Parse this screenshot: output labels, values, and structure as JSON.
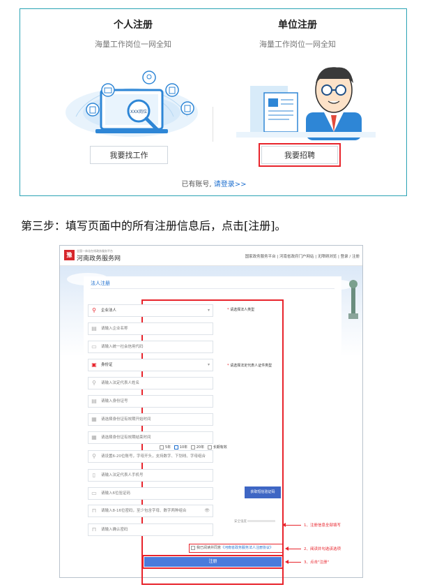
{
  "top": {
    "personal": {
      "title": "个人注册",
      "subtitle": "海量工作岗位一网全知",
      "button": "我要找工作",
      "badge": "XXX岗位"
    },
    "company": {
      "title": "单位注册",
      "subtitle": "海量工作岗位一网全知",
      "button": "我要招聘"
    },
    "login_prompt": "已有账号,",
    "login_link": "请登录>>"
  },
  "step_text": "第三步：填写页面中的所有注册信息后，点击[注册]。",
  "reg": {
    "logo_mark": "豫",
    "logo_small": "全国一体化在线政务服务平台",
    "site_name": "河南政务服务网",
    "top_links": "国家政务服务平台 | 河南省政府门户网站 | 无障碍浏览 | 登录 / 注册",
    "tab": "法人注册",
    "fields": [
      {
        "icon": "person-icon",
        "glyph": "⚲",
        "text": "企业法人",
        "select": true
      },
      {
        "icon": "building-icon",
        "glyph": "▤",
        "text": "请输入企业名称"
      },
      {
        "icon": "card-icon",
        "glyph": "▭",
        "text": "请输入统一社会信用代码"
      },
      {
        "icon": "id-badge-icon",
        "glyph": "▣",
        "text": "身份证",
        "select": true
      },
      {
        "icon": "user-icon",
        "glyph": "⚲",
        "text": "请输入法定代表人姓名"
      },
      {
        "icon": "id-card-icon",
        "glyph": "▤",
        "text": "请输入身份证号"
      },
      {
        "icon": "calendar-icon",
        "glyph": "▦",
        "text": "请选择身份证有效期开始时间"
      },
      {
        "icon": "calendar-icon",
        "glyph": "▦",
        "text": "请选择身份证有效期结束时间"
      },
      {
        "icon": "user-icon",
        "glyph": "⚲",
        "text": "请设置6-20位账号，字母开头，支持数字、下划线、字母组合"
      },
      {
        "icon": "phone-icon",
        "glyph": "▯",
        "text": "请输入法定代表人手机号"
      },
      {
        "icon": "message-icon",
        "glyph": "▭",
        "text": "请输入6位验证码"
      },
      {
        "icon": "lock-icon",
        "glyph": "⊓",
        "text": "请输入8-16位密码，至少包含字母、数字两种组合",
        "eye": "👁"
      },
      {
        "icon": "lock-icon",
        "glyph": "⊓",
        "text": "请输入确认密码"
      }
    ],
    "hint_type": "请选择法人类型",
    "hint_id_type": "请选择法定代表人证件类型",
    "validity_options": [
      "5年",
      "10年",
      "20年",
      "长期有效"
    ],
    "sms_button": "获取短信验证码",
    "pw_strength": "安全强度",
    "agree_text": "我已阅读并同意",
    "agree_link": "《河南省政务服务法人注册协议》",
    "submit": "注册",
    "annotations": [
      "1、注册信息全部填写",
      "2、阅读并勾选该选项",
      "3、点击\"注册\""
    ]
  }
}
